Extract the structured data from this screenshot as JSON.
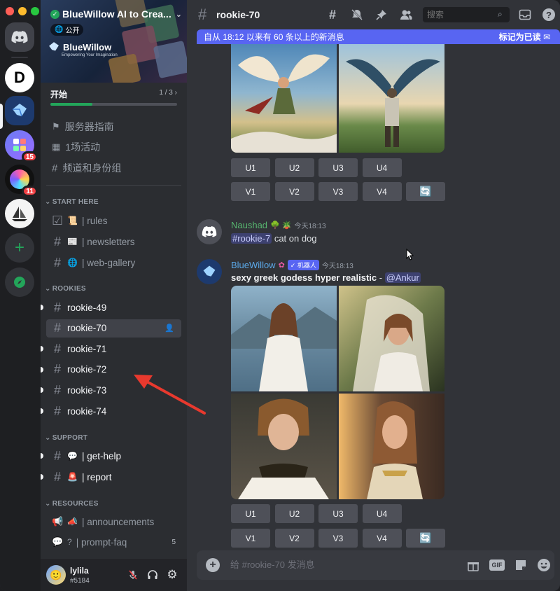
{
  "servers": [
    {
      "name": "discord-home",
      "badge": ""
    },
    {
      "name": "D",
      "badge": ""
    },
    {
      "name": "bluewillow",
      "badge": ""
    },
    {
      "name": "server-4",
      "badge": "15"
    },
    {
      "name": "server-5",
      "badge": "11"
    },
    {
      "name": "server-6",
      "badge": ""
    }
  ],
  "server": {
    "title": "BlueWillow AI to Crea...",
    "visibility": "公开",
    "brand_name": "BlueWillow",
    "brand_tagline": "Empowering Your Imagination"
  },
  "onboarding": {
    "label": "开始",
    "count": "1 / 3",
    "progress": 0.33
  },
  "nav": {
    "guide": "服务器指南",
    "events": "1场活动",
    "channels_roles": "频道和身份组"
  },
  "categories": {
    "start_here": "START HERE",
    "rookies": "ROOKIES",
    "support": "SUPPORT",
    "resources": "RESOURCES"
  },
  "start_here_channels": [
    {
      "icon": "☑",
      "emoji": "📜",
      "name": "| rules"
    },
    {
      "icon": "#",
      "emoji": "📰",
      "name": "| newsletters"
    },
    {
      "icon": "#",
      "emoji": "🌐",
      "name": "| web-gallery"
    }
  ],
  "rookie_channels": [
    {
      "name": "rookie-49",
      "unread": true,
      "active": false
    },
    {
      "name": "rookie-70",
      "unread": false,
      "active": true
    },
    {
      "name": "rookie-71",
      "unread": true,
      "active": false
    },
    {
      "name": "rookie-72",
      "unread": true,
      "active": false
    },
    {
      "name": "rookie-73",
      "unread": true,
      "active": false
    },
    {
      "name": "rookie-74",
      "unread": true,
      "active": false
    }
  ],
  "support_channels": [
    {
      "emoji": "💬",
      "name": "| get-help"
    },
    {
      "emoji": "🚨",
      "name": "| report"
    }
  ],
  "resource_channels": [
    {
      "emoji": "📣",
      "name": "| announcements",
      "count": ""
    },
    {
      "emoji": "?",
      "name": "| prompt-faq",
      "count": "5"
    }
  ],
  "user": {
    "name": "lylila",
    "tag": "#5184"
  },
  "channel": {
    "title": "rookie-70",
    "search_placeholder": "搜索"
  },
  "new_messages": {
    "text": "自从 18:12 以来有 60 条以上的新消息",
    "action": "标记为已读"
  },
  "upscale_buttons": [
    "U1",
    "U2",
    "U3",
    "U4"
  ],
  "variation_buttons": [
    "V1",
    "V2",
    "V3",
    "V4"
  ],
  "messages": [
    {
      "author": "Naushad",
      "badges": "🌳 🪴",
      "time": "今天18:13",
      "mention": "#rookie-7",
      "text": " cat on dog"
    },
    {
      "author": "BlueWillow",
      "bot_label": "✓ 机器人",
      "time": "今天18:13",
      "prompt": "sexy greek godess hyper realistic",
      "separator": " - ",
      "mention": "@Ankur"
    }
  ],
  "composer": {
    "placeholder": "给 #rookie-70 发消息"
  },
  "colors": {
    "accent": "#5865f2",
    "online": "#23a55a",
    "badge": "#f23f43"
  }
}
